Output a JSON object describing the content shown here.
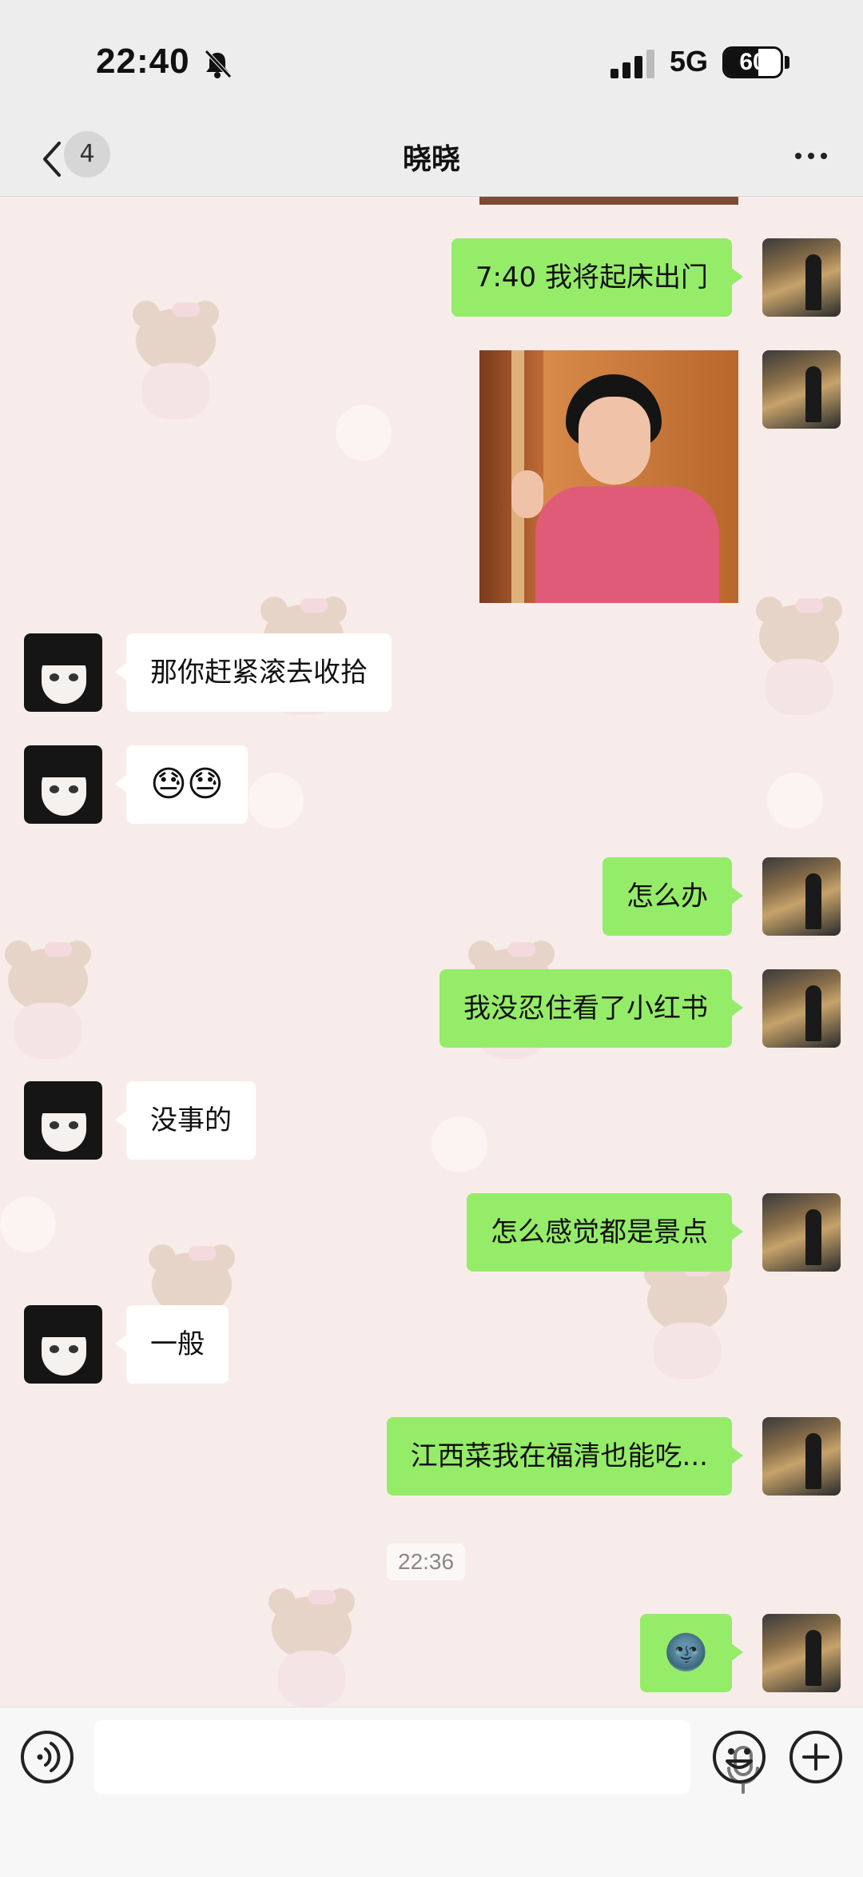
{
  "status_bar": {
    "time": "22:40",
    "network": "5G",
    "battery": "60",
    "battery_level": 0.6,
    "icons": [
      "bell-mute-icon",
      "signal-icon",
      "battery-icon"
    ]
  },
  "nav": {
    "title": "晓晓",
    "unread_count": "4",
    "icons": [
      "back-chevron-icon",
      "more-dots-icon"
    ]
  },
  "messages": [
    {
      "side": "right",
      "type": "text",
      "text": "7:40 我将起床出门"
    },
    {
      "side": "right",
      "type": "image",
      "alt": "photo-message"
    },
    {
      "side": "left",
      "type": "text",
      "text": "那你赶紧滚去收拾"
    },
    {
      "side": "left",
      "type": "text",
      "text": "😓😓"
    },
    {
      "side": "right",
      "type": "text",
      "text": "怎么办"
    },
    {
      "side": "right",
      "type": "text",
      "text": "我没忍住看了小红书"
    },
    {
      "side": "left",
      "type": "text",
      "text": "没事的"
    },
    {
      "side": "right",
      "type": "text",
      "text": "怎么感觉都是景点"
    },
    {
      "side": "left",
      "type": "text",
      "text": "一般"
    },
    {
      "side": "right",
      "type": "text",
      "text": "江西菜我在福清也能吃..."
    },
    {
      "side": "right",
      "type": "text",
      "text": "🌚"
    }
  ],
  "timestamp": "22:36",
  "input_bar": {
    "icons": [
      "voice-icon",
      "microphone-icon",
      "emoji-icon",
      "plus-icon"
    ]
  },
  "colors": {
    "sent_bubble": "#95ec69",
    "received_bubble": "#ffffff",
    "chat_background": "#f7ecea",
    "bar_background": "#ededed"
  }
}
